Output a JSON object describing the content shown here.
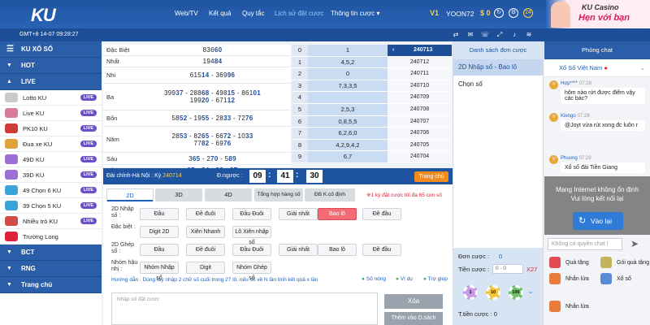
{
  "header": {
    "logo": "KU",
    "nav": [
      "Web/TV",
      "Kết quả",
      "Quy tắc",
      "Lịch sử đặt cược",
      "Thông tin cược"
    ],
    "nav_caret": "▾",
    "vip": "V1",
    "username": "YOON72",
    "balance": "$ 0",
    "promo_line1": "KU Casino",
    "promo_line2": "Hẹn với bạn",
    "badge_24": "24"
  },
  "subheader": {
    "clock": "GMT+8 14-07 09:28:27"
  },
  "sidebar": {
    "title": "KU XỔ SỐ",
    "sections": [
      "HOT",
      "LIVE"
    ],
    "items": [
      {
        "label": "Lotto KU",
        "live": "LIVE",
        "color": "#c9c9c9"
      },
      {
        "label": "Live KU",
        "live": "LIVE",
        "color": "#d87b9c"
      },
      {
        "label": "PK10 KU",
        "live": "LIVE",
        "color": "#cf3b3b"
      },
      {
        "label": "Đua xe KU",
        "live": "LIVE",
        "color": "#e0a23a"
      },
      {
        "label": "49D KU",
        "live": "LIVE",
        "color": "#9b6fd6"
      },
      {
        "label": "39D KU",
        "live": "LIVE",
        "color": "#9b6fd6"
      },
      {
        "label": "49 Chọn 6 KU",
        "live": "LIVE",
        "color": "#3aa4d9"
      },
      {
        "label": "39 Chọn 5 KU",
        "live": "LIVE",
        "color": "#3aa4d9"
      },
      {
        "label": "Nhiều trò KU",
        "live": "LIVE",
        "color": "#d24b4b"
      },
      {
        "label": "Trường Long",
        "live": "",
        "color": "#e0213a"
      }
    ],
    "bottom_sections": [
      "BCT",
      "RNG",
      "Trang chủ"
    ]
  },
  "results": [
    {
      "label": "Đặc Biệt",
      "lines": [
        [
          "836",
          "60"
        ]
      ]
    },
    {
      "label": "Nhất",
      "lines": [
        [
          "194",
          "84"
        ]
      ]
    },
    {
      "label": "Nhì",
      "lines": [
        [
          "615",
          "14"
        ],
        [
          " - 369",
          "96"
        ]
      ]
    },
    {
      "label": "Ba",
      "lines": [
        [
          "399",
          "37"
        ],
        [
          " - 288",
          "68"
        ],
        [
          " - 498",
          "15"
        ],
        [
          " - 861",
          "01"
        ],
        [
          "199",
          "20"
        ],
        [
          " - 671",
          "12"
        ]
      ]
    },
    {
      "label": "Bốn",
      "lines": [
        [
          "58",
          "52"
        ],
        [
          " - 19",
          "55"
        ],
        [
          " - 28",
          "33"
        ],
        [
          " - 72",
          "76"
        ]
      ]
    },
    {
      "label": "Năm",
      "lines": [
        [
          "28",
          "53"
        ],
        [
          " - 82",
          "65"
        ],
        [
          " - 66",
          "72"
        ],
        [
          " - 10",
          "33"
        ],
        [
          "77",
          "82"
        ],
        [
          " - 69",
          "76"
        ]
      ]
    },
    {
      "label": "Sáu",
      "lines": [
        [
          "3",
          "65"
        ],
        [
          " - 2",
          "70"
        ],
        [
          " - 5",
          "89"
        ]
      ]
    },
    {
      "label": "Bảy",
      "lines": [
        [
          "",
          "35"
        ],
        [
          " - ",
          "84"
        ],
        [
          " - ",
          "82"
        ],
        [
          " - ",
          "97"
        ]
      ]
    }
  ],
  "result_table": {
    "header_label": "240713",
    "header_nav": "‹",
    "rows": [
      {
        "a": "0",
        "b": "1",
        "c": ""
      },
      {
        "a": "1",
        "b": "4,5,2",
        "c": "240712"
      },
      {
        "a": "2",
        "b": "0",
        "c": "240711"
      },
      {
        "a": "3",
        "b": "7,3,3,5",
        "c": "240710"
      },
      {
        "a": "4",
        "b": "",
        "c": "240709"
      },
      {
        "a": "5",
        "b": "2,5,3",
        "c": "240708"
      },
      {
        "a": "6",
        "b": "0,8,5,5",
        "c": "240707"
      },
      {
        "a": "7",
        "b": "6,2,6,0",
        "c": "240706"
      },
      {
        "a": "8",
        "b": "4,2,9,4,2",
        "c": "240705"
      },
      {
        "a": "9",
        "b": "6,7",
        "c": "240704"
      }
    ]
  },
  "countdown": {
    "region": "Đài chính-Hà Nội : Kỳ",
    "period": "240714",
    "label": "Đ.ngược :",
    "hh": "09",
    "mm": "41",
    "ss": "30",
    "button": "Trang chủ"
  },
  "bet": {
    "tabs": [
      "2D",
      "3D",
      "4D",
      "Tổng hợp hàng số",
      "ĐB K.cố định"
    ],
    "warning": "※1 kỳ đặt cược tối đa 65 con số",
    "rows": [
      {
        "label": "2D Nhập số :",
        "buttons": [
          "Đầu",
          "Đề đuôi",
          "Đầu Đuôi",
          "Giải nhất",
          "Bao lô",
          "Đề đầu"
        ]
      },
      {
        "label": "Đặc biệt :",
        "buttons": [
          "Digit 2D",
          "Xiên Nhanh",
          "Lô Xiên nhập số"
        ]
      },
      {
        "label": "2D Ghép số :",
        "buttons": [
          "Đầu",
          "Đề đuôi",
          "Đầu Đuôi",
          "Giải nhất",
          "Bao lô",
          "Đề đầu"
        ]
      },
      {
        "label": "Nhóm hậu nhị :",
        "buttons": [
          "Nhóm Nhập số",
          "Digit",
          "Nhóm Ghép số"
        ]
      }
    ],
    "hint": "Hướng dẫn : Dùng tay nhập 2 chữ số cuối trong 27 lô, nếu số về N lần tính kết quả x lần",
    "links": [
      "Số nóng",
      "Ví dụ",
      "Trợ giúp"
    ],
    "textarea_placeholder": "Nhập số đặt cược",
    "delete_btn": "Xóa",
    "add_btn": "Thêm vào D.sách"
  },
  "order": {
    "header": "Danh sách đơn cược",
    "tab": "2D Nhập số - Bao lô",
    "choose": "Chọn số",
    "don_label": "Đơn cược :",
    "don_value": "0",
    "tien_label": "Tiền cược :",
    "tien_placeholder": "0 - 0",
    "multiplier": "X27",
    "total_label": "T.tiền cược :",
    "total_value": "0",
    "chips": [
      {
        "value": "1",
        "color": "#c59ce6"
      },
      {
        "value": "10",
        "color": "#f0c63b"
      },
      {
        "value": "100",
        "color": "#6cc36b"
      }
    ]
  },
  "chat": {
    "header": "Phòng chat",
    "room": "Xổ Số Việt Nam",
    "messages": [
      {
        "name": "Hợp****",
        "time": "07:28",
        "text": "hôm nào rứt được điểm vậy các bác?"
      },
      {
        "name": "Kiengo",
        "time": "07:28",
        "text": "@Joyt vừa rút xong đc luôn r"
      },
      {
        "name": "Phuong",
        "time": "07:29",
        "text": "Xổ số đài Tiền Giang"
      }
    ],
    "overlay_line1": "Mạng Internet không ổn định",
    "overlay_line2": "Vui lòng kết nối lại",
    "reconnect": "Vào lại",
    "input_placeholder": "Không có quyền chat !",
    "gift1": "Quà tặng",
    "gift2": "Gói quà tặng",
    "lottery1": "Nhắn lửa",
    "lottery2": "Xổ số",
    "lottery3": "Nhắn lửa"
  }
}
